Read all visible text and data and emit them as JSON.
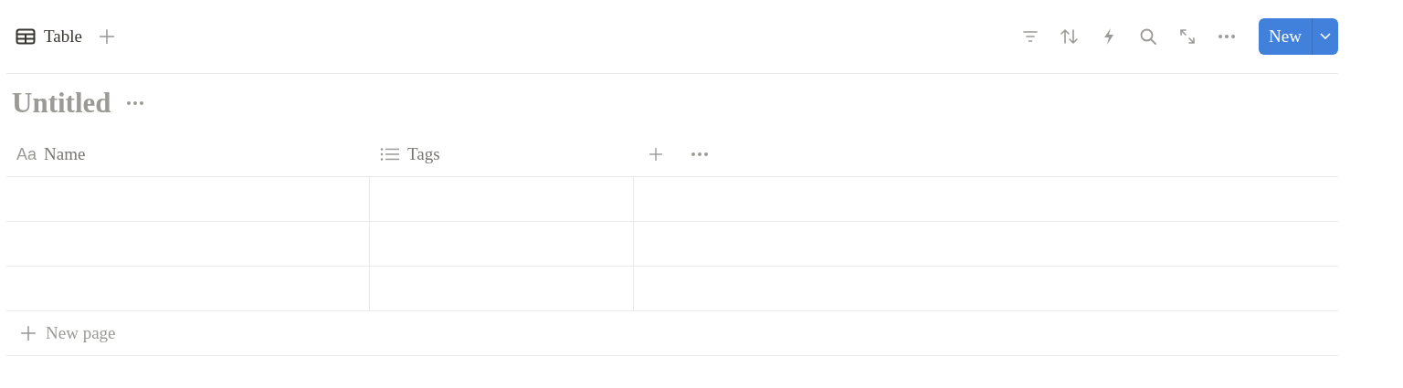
{
  "views": [
    {
      "label": "Table"
    }
  ],
  "toolbar": [
    {
      "kind": "filter"
    },
    {
      "kind": "sort"
    },
    {
      "kind": "automation"
    },
    {
      "kind": "search"
    },
    {
      "kind": "expand"
    },
    {
      "kind": "more"
    }
  ],
  "new_button": {
    "label": "New"
  },
  "title": "Untitled",
  "table": {
    "columns": [
      {
        "kind": "title",
        "icon": "Aa",
        "label": "Name"
      },
      {
        "kind": "multi_select",
        "label": "Tags"
      }
    ],
    "rows": [
      {
        "kind": "empty"
      },
      {
        "kind": "empty"
      },
      {
        "kind": "empty"
      }
    ],
    "add_row": "New page"
  }
}
